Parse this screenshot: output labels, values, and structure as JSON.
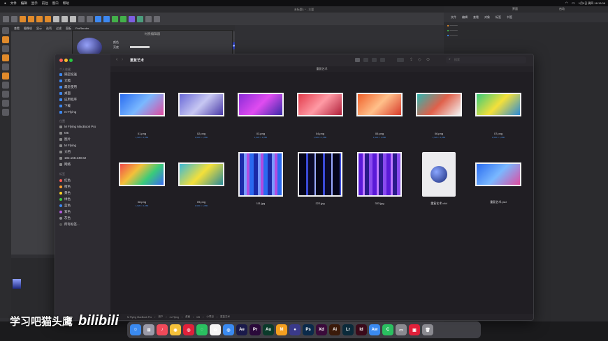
{
  "menubar": {
    "items": [
      "文件",
      "编辑",
      "显示",
      "前往",
      "窗口",
      "帮助"
    ],
    "time": "1月9日 周四 18:13:06"
  },
  "c4d": {
    "title": "未标题1 * - 主要",
    "viewport_menu": [
      "查看",
      "摄像机",
      "显示",
      "选项",
      "过滤",
      "面板",
      "ProRender"
    ],
    "right_tabs": [
      "文件",
      "编辑",
      "查看",
      "对象",
      "标签",
      "书签"
    ],
    "right_tabs2": [
      "模式",
      "编辑",
      "用户数据"
    ],
    "dialog_title": "材质编辑器",
    "dialog_label": "颜色",
    "dialog_sublabel": "亮度",
    "layout_label": "界面",
    "layout_value": "启动"
  },
  "finder": {
    "title": "重复艺术",
    "window_title": "重复艺术",
    "search_placeholder": "搜索",
    "sidebar": {
      "favorites_header": "个人收藏",
      "favorites": [
        "隔空投送",
        "文稿",
        "最近使用",
        "桌面",
        "应用程序",
        "下载",
        "m-Flying"
      ],
      "locations_header": "位置",
      "locations": [
        "M Flying MacBook Pro",
        "M5",
        "图片",
        "M Flying",
        "文档",
        "192.168.249.62",
        "网络"
      ],
      "tags_header": "标签",
      "tags": [
        {
          "name": "红色",
          "color": "#ff5a52"
        },
        {
          "name": "橙色",
          "color": "#ff9f2e"
        },
        {
          "name": "黄色",
          "color": "#ffd426"
        },
        {
          "name": "绿色",
          "color": "#3ec743"
        },
        {
          "name": "蓝色",
          "color": "#3d88f0"
        },
        {
          "name": "紫色",
          "color": "#b45bdf"
        },
        {
          "name": "灰色",
          "color": "#8e8e93"
        },
        {
          "name": "所有标签...",
          "color": "#555555"
        }
      ]
    },
    "files": [
      {
        "name": "01.png",
        "dims": "1,920 × 1,080",
        "kind": "blue"
      },
      {
        "name": "02.png",
        "dims": "1,920 × 1,080",
        "kind": "purple"
      },
      {
        "name": "03.png",
        "dims": "1,920 × 1,080",
        "kind": "magenta"
      },
      {
        "name": "04.png",
        "dims": "1,920 × 1,080",
        "kind": "red"
      },
      {
        "name": "05.png",
        "dims": "1,920 × 1,080",
        "kind": "orange"
      },
      {
        "name": "06.png",
        "dims": "1,920 × 1,080",
        "kind": "teal-red"
      },
      {
        "name": "07.png",
        "dims": "1,920 × 1,080",
        "kind": "green"
      },
      {
        "name": "08.png",
        "dims": "1,920 × 1,080",
        "kind": "rainbow"
      },
      {
        "name": "09.png",
        "dims": "1,920 × 1,080",
        "kind": "teal"
      },
      {
        "name": "111.jpg",
        "dims": "",
        "kind": "stripes-blue"
      },
      {
        "name": "222.jpg",
        "dims": "",
        "kind": "stripes-dark"
      },
      {
        "name": "333.jpg",
        "dims": "",
        "kind": "stripes-purple"
      },
      {
        "name": "重复艺术.c4d",
        "dims": "",
        "kind": "c4d"
      },
      {
        "name": "重复艺术.psd",
        "dims": "",
        "kind": "blue"
      }
    ],
    "path": [
      "M Flying MacBook Pro",
      "用户",
      "m-Flying",
      "桌面",
      "M5",
      "小项目",
      "重复艺术"
    ]
  },
  "dock": [
    "Finder",
    "Launchpad",
    "音乐",
    "Chrome",
    "网易云音乐",
    "微信",
    "照片",
    "Safari",
    "Ae",
    "Pr",
    "Au",
    "M",
    "Cinema 4D",
    "Ps",
    "Xd",
    "Ai",
    "Lr",
    "Id",
    "Aw",
    "C",
    "窗口",
    "Photo Booth",
    "废纸篓"
  ],
  "watermark": {
    "text": "学习吧猫头鹰",
    "logo": "bilibili"
  }
}
